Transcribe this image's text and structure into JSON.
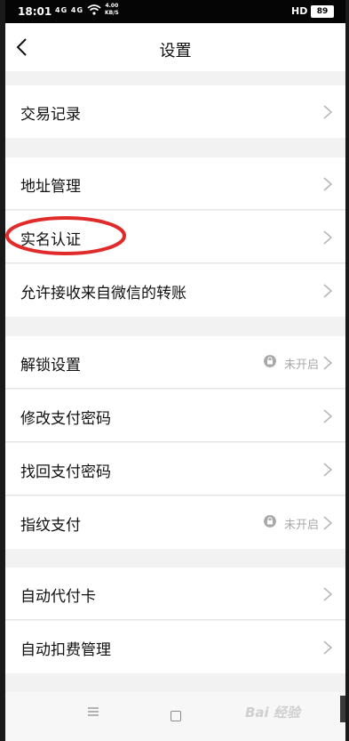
{
  "status_bar": {
    "time": "18:01",
    "network": "4G 4G",
    "speed": "4.00\nKB/S",
    "hd": "HD",
    "battery": "89"
  },
  "navbar": {
    "title": "设置"
  },
  "sections": [
    {
      "items": [
        {
          "label": "交易记录"
        }
      ]
    },
    {
      "items": [
        {
          "label": "地址管理"
        },
        {
          "label": "实名认证"
        },
        {
          "label": "允许接收来自微信的转账"
        }
      ]
    },
    {
      "items": [
        {
          "label": "解锁设置",
          "status": "未开启"
        },
        {
          "label": "修改支付密码"
        },
        {
          "label": "找回支付密码"
        },
        {
          "label": "指纹支付",
          "status": "未开启"
        }
      ]
    },
    {
      "items": [
        {
          "label": "自动代付卡"
        },
        {
          "label": "自动扣费管理"
        }
      ]
    }
  ],
  "watermark": "Bai 经验",
  "colors": {
    "annotation_circle": "#e02b2b",
    "background": "#f2f2f2",
    "status_text": "#a8a8a8"
  }
}
